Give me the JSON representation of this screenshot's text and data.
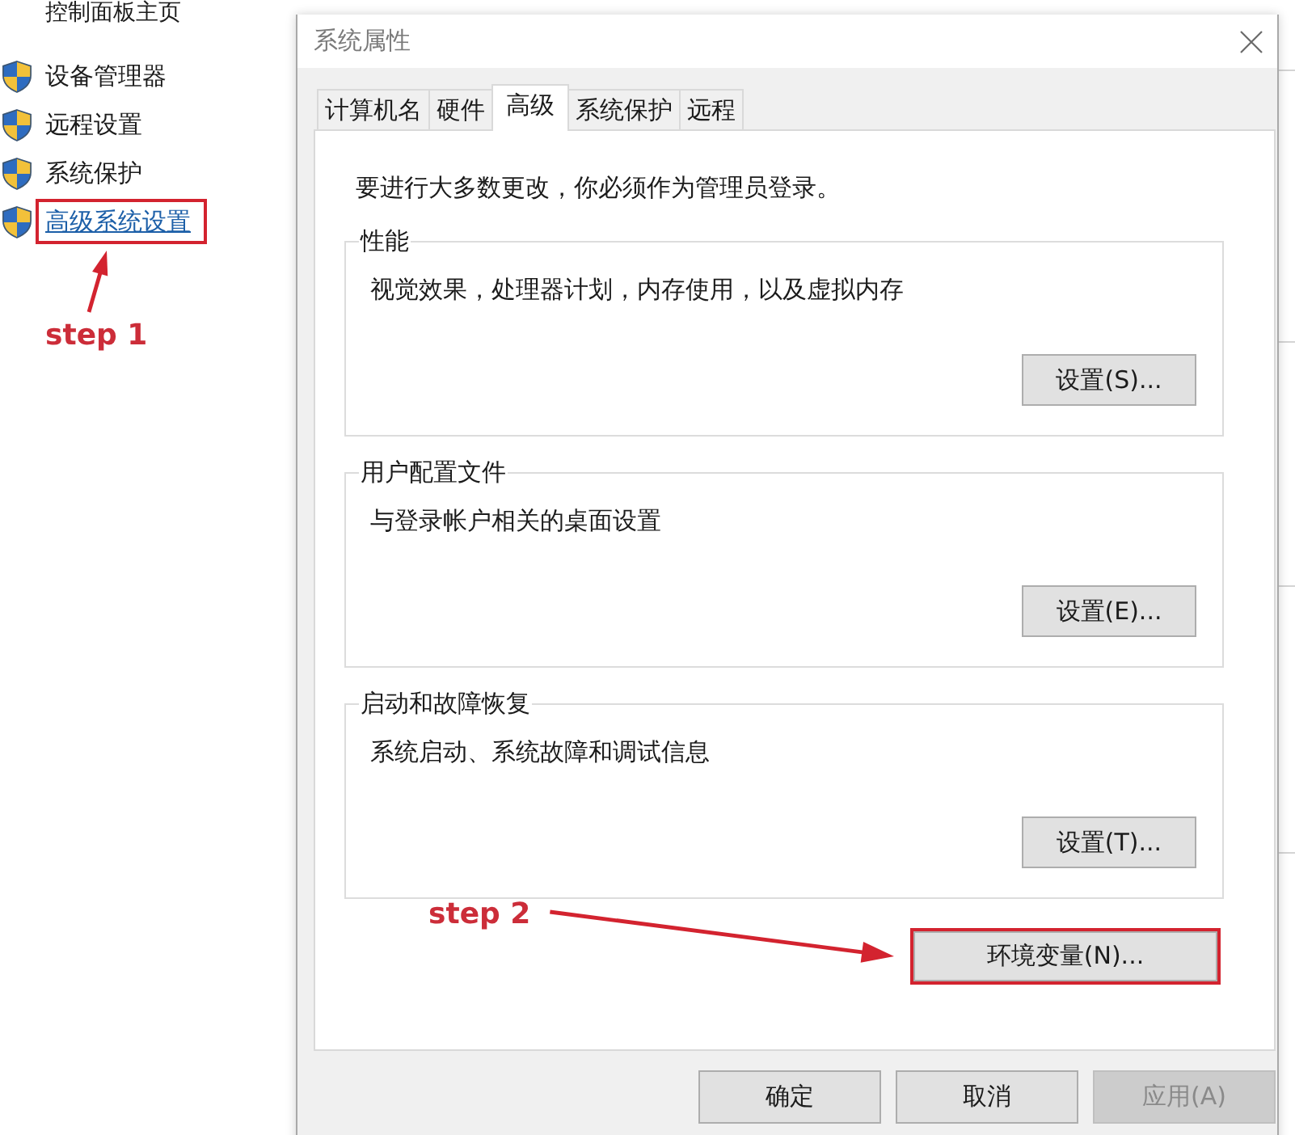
{
  "sidebar": {
    "home_link": "控制面板主页",
    "items": [
      {
        "label": "设备管理器",
        "hovered": false,
        "highlighted": false
      },
      {
        "label": "远程设置",
        "hovered": false,
        "highlighted": false
      },
      {
        "label": "系统保护",
        "hovered": false,
        "highlighted": false
      },
      {
        "label": "高级系统设置",
        "hovered": true,
        "highlighted": true
      }
    ],
    "step_label": "step 1"
  },
  "dialog": {
    "title": "系统属性",
    "tabs": [
      {
        "label": "计算机名",
        "selected": false
      },
      {
        "label": "硬件",
        "selected": false
      },
      {
        "label": "高级",
        "selected": true
      },
      {
        "label": "系统保护",
        "selected": false
      },
      {
        "label": "远程",
        "selected": false
      }
    ],
    "notice": "要进行大多数更改，你必须作为管理员登录。",
    "groups": [
      {
        "legend": "性能",
        "description": "视觉效果，处理器计划，内存使用，以及虚拟内存",
        "button": "设置(S)..."
      },
      {
        "legend": "用户配置文件",
        "description": "与登录帐户相关的桌面设置",
        "button": "设置(E)..."
      },
      {
        "legend": "启动和故障恢复",
        "description": "系统启动、系统故障和调试信息",
        "button": "设置(T)..."
      }
    ],
    "env_button": {
      "label": "环境变量(N)...",
      "highlighted": true
    },
    "step_label": "step 2",
    "buttons": [
      {
        "label": "确定",
        "disabled": false
      },
      {
        "label": "取消",
        "disabled": false
      },
      {
        "label": "应用(A)",
        "disabled": true
      }
    ]
  }
}
